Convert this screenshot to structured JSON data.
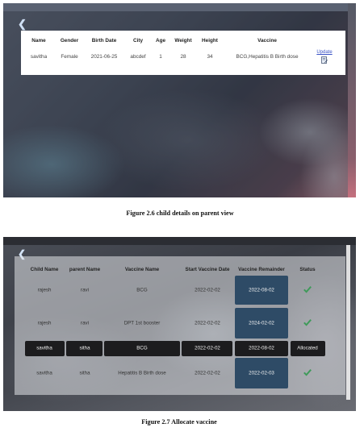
{
  "figure1": {
    "back_icon": "chevron-left-icon",
    "columns": [
      "Name",
      "Gender",
      "Birth Date",
      "City",
      "Age",
      "Weight",
      "Height",
      "Vaccine"
    ],
    "row": [
      "savitha",
      "Female",
      "2021-06-25",
      "abcdef",
      "1",
      "28",
      "34",
      "BCG,Hepatitis B Birth dose"
    ],
    "update_label": "Update",
    "update_icon": "edit-document-icon",
    "caption": "Figure 2.6 child details on parent view"
  },
  "figure2": {
    "back_icon": "chevron-left-icon",
    "columns": [
      "Child Name",
      "parent Name",
      "Vaccine Name",
      "Start Vaccine Date",
      "Vaccine Remainder",
      "Status"
    ],
    "rows": [
      {
        "child": "rajesh",
        "parent": "ravi",
        "vaccine": "BCG",
        "start": "2022-02-02",
        "remainder": "2022-08-02",
        "status": "check-icon"
      },
      {
        "child": "rajesh",
        "parent": "ravi",
        "vaccine": "DPT 1st booster",
        "start": "2022-02-02",
        "remainder": "2024-02-02",
        "status": "check-icon"
      },
      {
        "child": "savitha",
        "parent": "sitha",
        "vaccine": "BCG",
        "start": "2022-02-02",
        "remainder": "2022-08-02",
        "status": "Allocated"
      },
      {
        "child": "savitha",
        "parent": "sitha",
        "vaccine": "Hepatitis B Birth dose",
        "start": "2022-02-02",
        "remainder": "2022-02-03",
        "status": "check-icon"
      }
    ],
    "caption": "Figure 2.7 Allocate vaccine"
  },
  "colors": {
    "accent_link": "#3a53c5",
    "reminder_cell": "#2e4b66",
    "check_green": "#3f9a5a",
    "highlight_row": "#1c1c1e"
  }
}
